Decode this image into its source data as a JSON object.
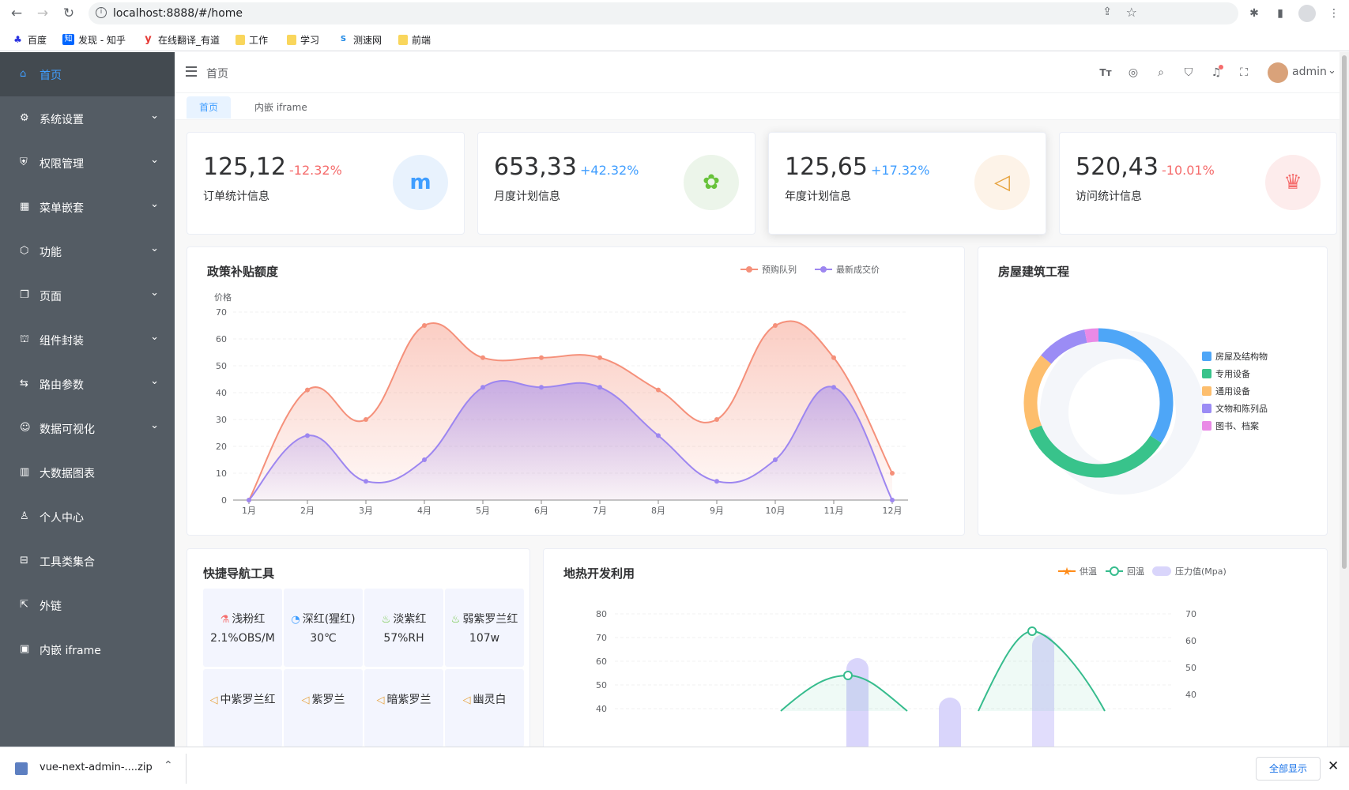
{
  "browser": {
    "url": "localhost:8888/#/home",
    "bookmarks": [
      "百度",
      "发现 - 知乎",
      "在线翻译_有道",
      "工作",
      "学习",
      "测速网",
      "前端"
    ]
  },
  "sidebar": {
    "items": [
      {
        "label": "首页",
        "icon": "home-icon",
        "expandable": false,
        "active": true
      },
      {
        "label": "系统设置",
        "icon": "gear-icon",
        "expandable": true
      },
      {
        "label": "权限管理",
        "icon": "shield-icon",
        "expandable": true
      },
      {
        "label": "菜单嵌套",
        "icon": "grid-icon",
        "expandable": true
      },
      {
        "label": "功能",
        "icon": "cube-icon",
        "expandable": true
      },
      {
        "label": "页面",
        "icon": "copy-icon",
        "expandable": true
      },
      {
        "label": "组件封装",
        "icon": "bricks-icon",
        "expandable": true
      },
      {
        "label": "路由参数",
        "icon": "route-icon",
        "expandable": true
      },
      {
        "label": "数据可视化",
        "icon": "chat-icon",
        "expandable": true
      },
      {
        "label": "大数据图表",
        "icon": "bar-chart-icon",
        "expandable": false
      },
      {
        "label": "个人中心",
        "icon": "user-icon",
        "expandable": false
      },
      {
        "label": "工具类集合",
        "icon": "toolbox-icon",
        "expandable": false
      },
      {
        "label": "外链",
        "icon": "external-link-icon",
        "expandable": false
      },
      {
        "label": "内嵌 iframe",
        "icon": "frame-icon",
        "expandable": false
      }
    ]
  },
  "header": {
    "breadcrumb": "首页",
    "username": "admin"
  },
  "tags": [
    "首页",
    "内嵌 iframe"
  ],
  "stats": [
    {
      "value": "125,12",
      "change": "-12.32%",
      "label": "订单统计信息",
      "change_color": "#f56c6c",
      "icon": "meetup-icon",
      "icon_bg": "#e8f2fd",
      "icon_color": "#409eff"
    },
    {
      "value": "653,33",
      "change": "+42.32%",
      "label": "月度计划信息",
      "change_color": "#409eff",
      "icon": "map-icon",
      "icon_bg": "#ecf5ea",
      "icon_color": "#67c23a"
    },
    {
      "value": "125,65",
      "change": "+17.32%",
      "label": "年度计划信息",
      "change_color": "#409eff",
      "icon": "speaker-icon",
      "icon_bg": "#fdf3e8",
      "icon_color": "#e6a23c"
    },
    {
      "value": "520,43",
      "change": "-10.01%",
      "label": "访问统计信息",
      "change_color": "#f56c6c",
      "icon": "github-icon",
      "icon_bg": "#fdecec",
      "icon_color": "#f56c6c"
    }
  ],
  "chart_data": [
    {
      "type": "area",
      "title": "政策补贴额度",
      "ylabel": "价格",
      "ylim": [
        0,
        70
      ],
      "yticks": [
        0,
        10,
        20,
        30,
        40,
        50,
        60,
        70
      ],
      "categories": [
        "1月",
        "2月",
        "3月",
        "4月",
        "5月",
        "6月",
        "7月",
        "8月",
        "9月",
        "10月",
        "11月",
        "12月"
      ],
      "legend_position": "top-right",
      "series": [
        {
          "name": "预购队列",
          "values": [
            0,
            41,
            30,
            65,
            53,
            53,
            53,
            41,
            30,
            65,
            53,
            10
          ],
          "color": "#f5907a"
        },
        {
          "name": "最新成交价",
          "values": [
            0,
            24,
            7,
            15,
            42,
            42,
            42,
            24,
            7,
            15,
            42,
            0
          ],
          "color": "#9d86f0"
        }
      ]
    },
    {
      "type": "pie",
      "title": "房屋建筑工程",
      "legend_position": "right",
      "slices": [
        {
          "name": "房屋及结构物",
          "value": 34,
          "color": "#4ea6f7"
        },
        {
          "name": "专用设备",
          "value": 35,
          "color": "#38c38b"
        },
        {
          "name": "通用设备",
          "value": 17,
          "color": "#fdbe6d"
        },
        {
          "name": "文物和陈列品",
          "value": 11,
          "color": "#9b8cf5"
        },
        {
          "name": "图书、档案",
          "value": 3,
          "color": "#e98ae6"
        }
      ]
    },
    {
      "type": "line",
      "title": "地热开发利用",
      "legend_position": "top-right",
      "yticks_left": [
        40,
        50,
        60,
        70,
        80
      ],
      "yticks_right": [
        40,
        50,
        60,
        70
      ],
      "series": [
        {
          "name": "供温",
          "color": "#ff8c1a"
        },
        {
          "name": "回温",
          "color": "#36bc8d"
        },
        {
          "name": "压力值(Mpa)",
          "color": "#d9d5fb"
        }
      ]
    }
  ],
  "nav_tools": {
    "title": "快捷导航工具",
    "items": [
      {
        "title": "浅粉红",
        "value": "2.1%OBS/M",
        "icon": "flask-icon",
        "color": "#f56c6c"
      },
      {
        "title": "深红(猩红)",
        "value": "30℃",
        "icon": "stopwatch-icon",
        "color": "#409eff"
      },
      {
        "title": "淡紫红",
        "value": "57%RH",
        "icon": "drops-icon",
        "color": "#67c23a"
      },
      {
        "title": "弱紫罗兰红",
        "value": "107w",
        "icon": "drops-icon",
        "color": "#67c23a"
      },
      {
        "title": "中紫罗兰红",
        "value": "",
        "icon": "speaker-icon",
        "color": "#e6a23c"
      },
      {
        "title": "紫罗兰",
        "value": "",
        "icon": "speaker-icon",
        "color": "#e6a23c"
      },
      {
        "title": "暗紫罗兰",
        "value": "",
        "icon": "speaker-icon",
        "color": "#e6a23c"
      },
      {
        "title": "幽灵白",
        "value": "",
        "icon": "speaker-icon",
        "color": "#e6a23c"
      }
    ]
  },
  "download": {
    "filename": "vue-next-admin-....zip",
    "show_all": "全部显示"
  }
}
